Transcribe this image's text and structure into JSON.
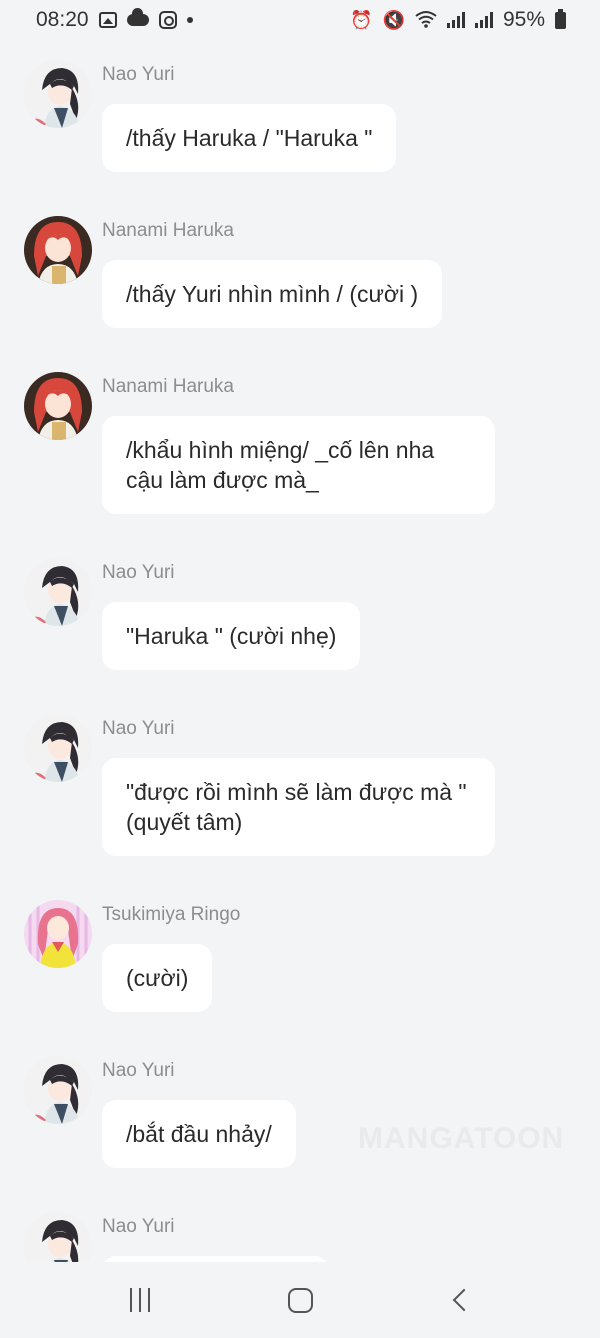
{
  "status_bar": {
    "time": "08:20",
    "battery": "95%",
    "left_icons": [
      "gallery-icon",
      "cloud-icon",
      "instagram-icon",
      "dot-icon"
    ],
    "right_icons": [
      "alarm-icon",
      "mute-icon",
      "wifi-icon",
      "signal-icon",
      "signal-icon",
      "battery-icon"
    ]
  },
  "messages": [
    {
      "sender": "Nao Yuri",
      "text": "/thấy Haruka / \"Haruka \"",
      "avatar": "nao-yuri"
    },
    {
      "sender": "Nanami Haruka",
      "text": "/thấy Yuri nhìn mình / (cười )",
      "avatar": "nanami-haruka"
    },
    {
      "sender": "Nanami Haruka",
      "text": "/khẩu hình miệng/ _cố lên nha cậu làm được mà_",
      "avatar": "nanami-haruka"
    },
    {
      "sender": "Nao Yuri",
      "text": "\"Haruka \" (cười nhẹ)",
      "avatar": "nao-yuri"
    },
    {
      "sender": "Nao Yuri",
      "text": "\"được rồi mình sẽ làm được mà \" (quyết tâm)",
      "avatar": "nao-yuri"
    },
    {
      "sender": "Tsukimiya Ringo",
      "text": "(cười)",
      "avatar": "tsukimiya-ringo"
    },
    {
      "sender": "Nao Yuri",
      "text": "/bắt đầu nhảy/",
      "avatar": "nao-yuri"
    },
    {
      "sender": "Nao Yuri",
      "text": "",
      "avatar": "nao-yuri"
    }
  ],
  "watermark": "MANGATOON",
  "colors": {
    "background": "#f3f4f6",
    "bubble": "#ffffff",
    "sender_name": "#8d8d8d",
    "text": "#2a2a2a"
  }
}
